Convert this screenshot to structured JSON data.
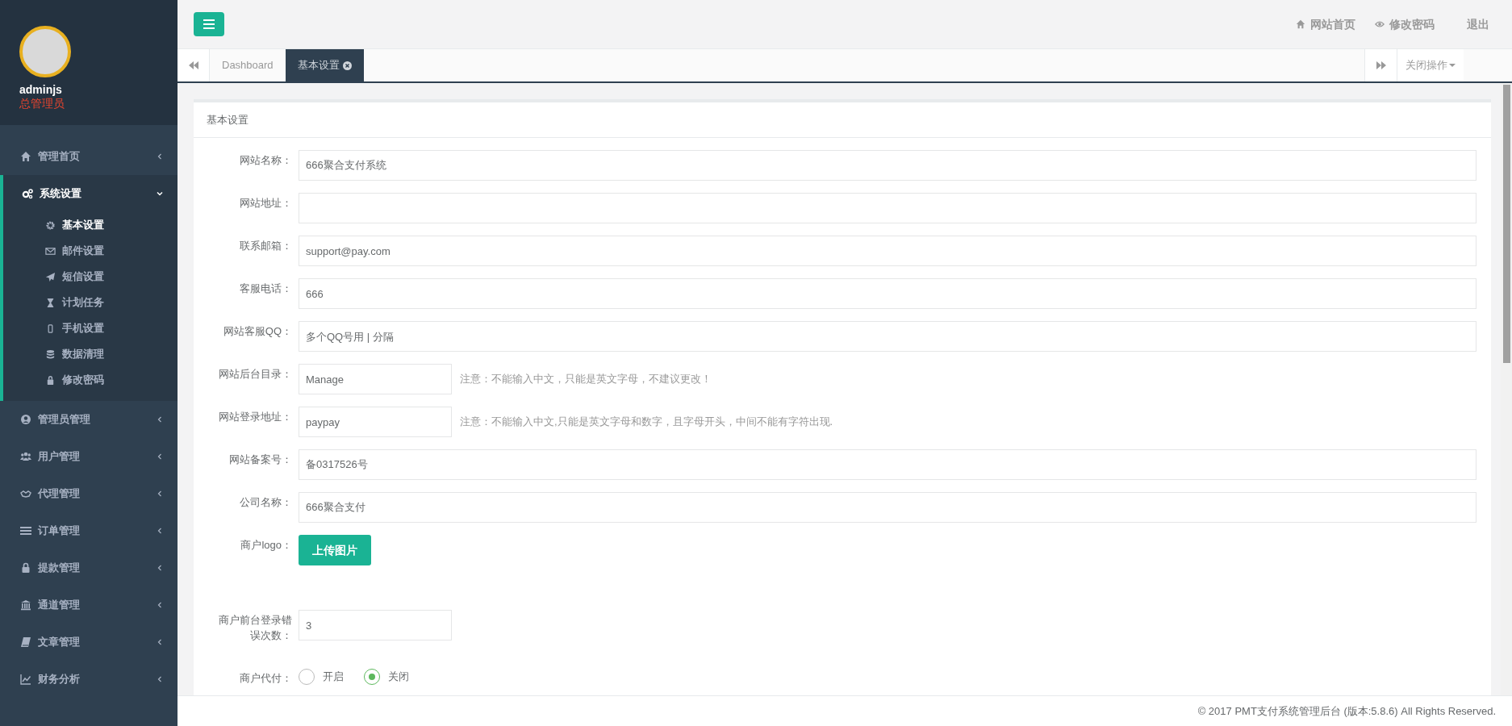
{
  "profile": {
    "username": "adminjs",
    "role": "总管理员"
  },
  "sidebar": {
    "items": [
      {
        "label": "管理首页",
        "expanded": false
      },
      {
        "label": "系统设置",
        "expanded": true,
        "children": [
          {
            "label": "基本设置",
            "selected": true
          },
          {
            "label": "邮件设置",
            "selected": false
          },
          {
            "label": "短信设置",
            "selected": false
          },
          {
            "label": "计划任务",
            "selected": false
          },
          {
            "label": "手机设置",
            "selected": false
          },
          {
            "label": "数据清理",
            "selected": false
          },
          {
            "label": "修改密码",
            "selected": false
          }
        ]
      },
      {
        "label": "管理员管理",
        "expanded": false
      },
      {
        "label": "用户管理",
        "expanded": false
      },
      {
        "label": "代理管理",
        "expanded": false
      },
      {
        "label": "订单管理",
        "expanded": false
      },
      {
        "label": "提款管理",
        "expanded": false
      },
      {
        "label": "通道管理",
        "expanded": false
      },
      {
        "label": "文章管理",
        "expanded": false
      },
      {
        "label": "财务分析",
        "expanded": false
      }
    ]
  },
  "header_links": [
    "网站首页",
    "修改密码",
    "退出"
  ],
  "tabs": [
    {
      "label": "Dashboard",
      "selected": false,
      "closable": false
    },
    {
      "label": "基本设置",
      "selected": true,
      "closable": true
    }
  ],
  "close_menu": "关闭操作",
  "panel": {
    "title": "基本设置",
    "fields": [
      {
        "kind": "text",
        "label": "网站名称：",
        "value": "666聚合支付系统"
      },
      {
        "kind": "text",
        "label": "网站地址："
      },
      {
        "kind": "text",
        "label": "联系邮箱：",
        "value": "support@pay.com"
      },
      {
        "kind": "text",
        "label": "客服电话：",
        "value": "666"
      },
      {
        "kind": "text",
        "label": "网站客服QQ：",
        "placeholder": "多个QQ号用 | 分隔"
      },
      {
        "kind": "short",
        "label": "网站后台目录：",
        "value": "Manage",
        "note": "注意：不能输入中文，只能是英文字母，不建议更改！"
      },
      {
        "kind": "short",
        "label": "网站登录地址：",
        "value": "paypay",
        "note": "注意：不能输入中文,只能是英文字母和数字，且字母开头，中间不能有字符出现."
      },
      {
        "kind": "text",
        "label": "网站备案号：",
        "value": "备0317526号"
      },
      {
        "kind": "text",
        "label": "公司名称：",
        "value": "666聚合支付"
      },
      {
        "kind": "upload",
        "label": "商户logo：",
        "button": "上传图片"
      },
      {
        "kind": "short",
        "label": "商户前台登录错误次数：",
        "value": "3"
      },
      {
        "kind": "radio",
        "label": "商户代付：",
        "options": [
          {
            "label": "开启",
            "selected": false
          },
          {
            "label": "关闭",
            "selected": true
          }
        ]
      }
    ]
  },
  "footer": "© 2017 PMT支付系统管理后台 (版本:5.8.6) All Rights Reserved."
}
